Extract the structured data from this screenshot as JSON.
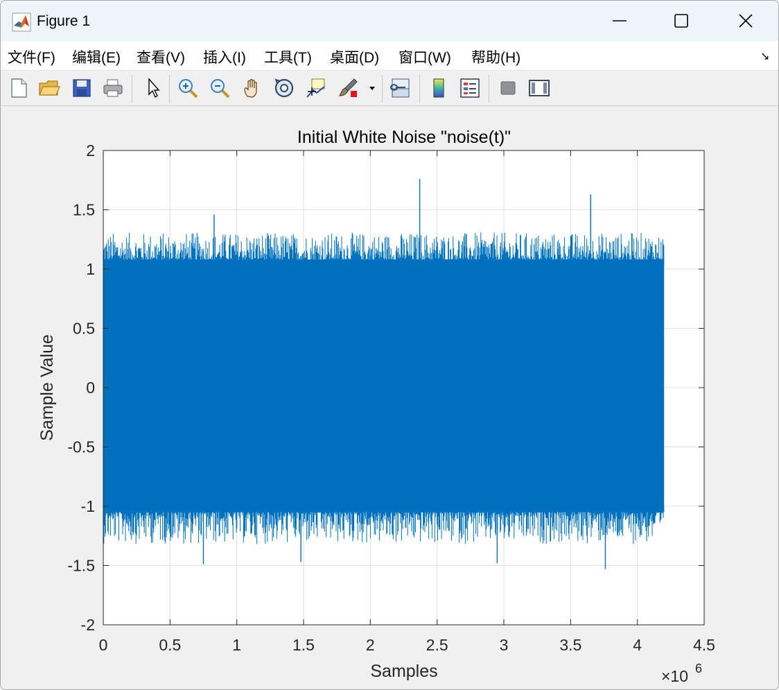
{
  "window": {
    "title": "Figure 1",
    "icon": "matlab-icon",
    "controls": {
      "minimize": "minimize-icon",
      "maximize": "maximize-icon",
      "close": "close-icon"
    }
  },
  "menu": {
    "items": [
      {
        "label": "文件(F)"
      },
      {
        "label": "编辑(E)"
      },
      {
        "label": "查看(V)"
      },
      {
        "label": "插入(I)"
      },
      {
        "label": "工具(T)"
      },
      {
        "label": "桌面(D)"
      },
      {
        "label": "窗口(W)"
      },
      {
        "label": "帮助(H)"
      }
    ],
    "dock_arrow": "↘"
  },
  "toolbar": {
    "buttons": [
      "new-figure-icon",
      "open-file-icon",
      "save-figure-icon",
      "print-figure-icon",
      "edit-plot-icon",
      "zoom-in-icon",
      "zoom-out-icon",
      "pan-icon",
      "rotate-3d-icon",
      "data-cursor-icon",
      "brush-icon",
      "brush-dropdown-icon",
      "link-plot-icon",
      "insert-colorbar-icon",
      "insert-legend-icon",
      "hide-plot-tools-icon",
      "show-plot-tools-icon"
    ]
  },
  "chart_data": {
    "type": "line",
    "title": "Initial White Noise \"noise(t)\"",
    "xlabel": "Samples",
    "ylabel": "Sample Value",
    "xlim": [
      0,
      4.5
    ],
    "ylim": [
      -2,
      2
    ],
    "x_exponent_label": "×10",
    "x_exponent": "6",
    "x_ticks": [
      "0",
      "0.5",
      "1",
      "1.5",
      "2",
      "2.5",
      "3",
      "3.5",
      "4",
      "4.5"
    ],
    "y_ticks": [
      "2",
      "1.5",
      "1",
      "0.5",
      "0",
      "-0.5",
      "-1",
      "-1.5",
      "-2"
    ],
    "grid": true,
    "series": [
      {
        "color": "#0072BD",
        "x_range": [
          0,
          4.2
        ],
        "dense_band": [
          -1.05,
          1.08
        ],
        "typical_peaks": [
          -1.25,
          1.25
        ],
        "extremes": [
          {
            "x": 2.37,
            "y": 1.76
          },
          {
            "x": 3.65,
            "y": 1.63
          },
          {
            "x": 0.83,
            "y": 1.46
          },
          {
            "x": 3.76,
            "y": -1.53
          },
          {
            "x": 0.75,
            "y": -1.49
          },
          {
            "x": 2.95,
            "y": -1.48
          },
          {
            "x": 1.48,
            "y": -1.47
          }
        ]
      }
    ]
  }
}
